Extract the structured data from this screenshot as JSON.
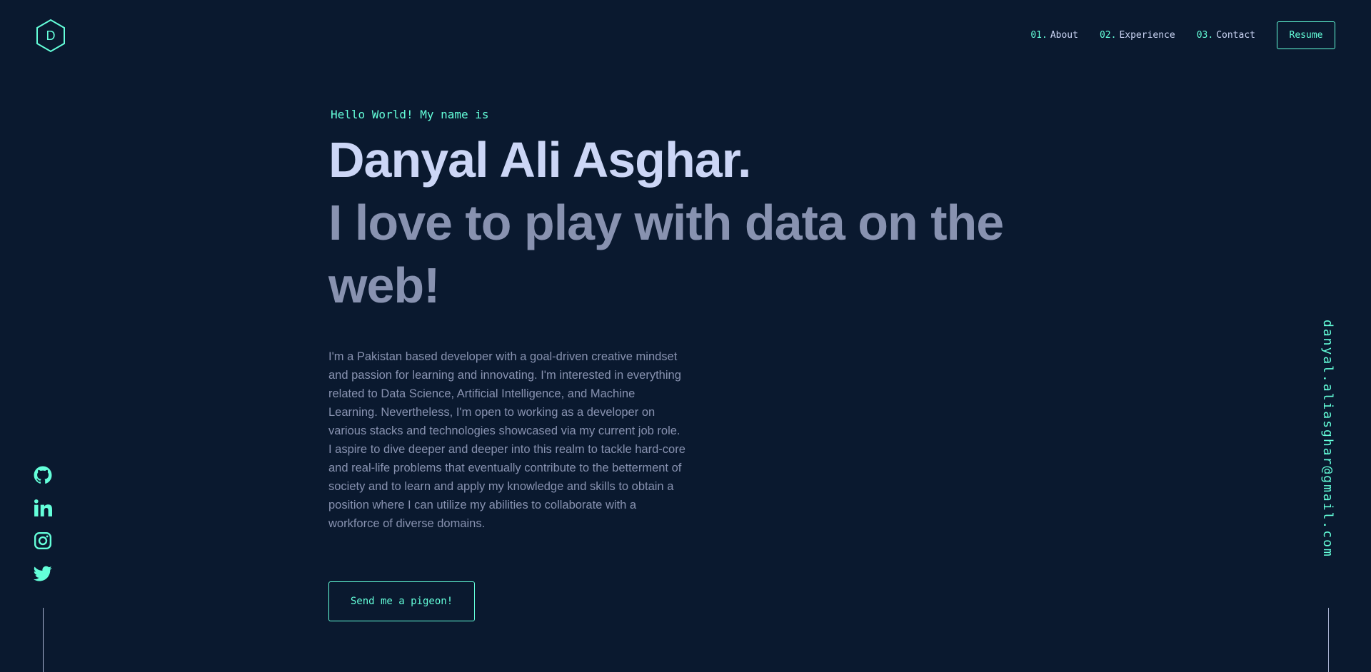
{
  "logo": {
    "letter": "D"
  },
  "nav": {
    "items": [
      {
        "num": "01.",
        "label": "About"
      },
      {
        "num": "02.",
        "label": "Experience"
      },
      {
        "num": "03.",
        "label": "Contact"
      }
    ],
    "resume_label": "Resume"
  },
  "hero": {
    "greeting": "Hello World! My name is",
    "name": "Danyal Ali Asghar.",
    "tagline": "I love to play with data on the web!",
    "bio": "I'm a Pakistan based developer with a goal-driven creative mindset and passion for learning and innovating. I'm interested in everything related to Data Science, Artificial Intelligence, and Machine Learning. Nevertheless, I'm open to working as a developer on various stacks and technologies showcased via my current job role. I aspire to dive deeper and deeper into this realm to tackle hard-core and real-life problems that eventually contribute to the betterment of society and to learn and apply my knowledge and skills to obtain a position where I can utilize my abilities to collaborate with a workforce of diverse domains.",
    "cta_label": "Send me a pigeon!"
  },
  "social": {
    "icons": [
      "github-icon",
      "linkedin-icon",
      "instagram-icon",
      "twitter-icon"
    ]
  },
  "email": "danyal.aliasghar@gmail.com",
  "colors": {
    "background": "#0a192f",
    "accent": "#64ffda",
    "heading": "#ccd6f6",
    "text": "#8892b0"
  }
}
